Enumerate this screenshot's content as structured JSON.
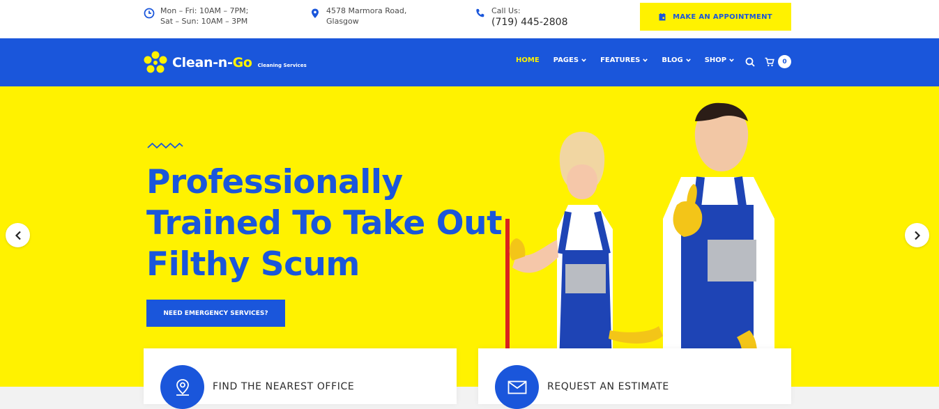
{
  "topbar": {
    "hours_line1": "Mon – Fri: 10AM – 7PM;",
    "hours_line2": "Sat – Sun: 10AM – 3PM",
    "address_line1": "4578 Marmora Road,",
    "address_line2": "Glasgow",
    "call_label": "Call Us:",
    "phone": "(719) 445-2808",
    "appointment_button": "MAKE AN APPOINTMENT",
    "icons": [
      "clock-icon",
      "map-pin-icon",
      "phone-icon",
      "calendar-icon"
    ]
  },
  "navbar": {
    "logo_main": "Clean-n-",
    "logo_accent": "Go",
    "logo_tagline": "Cleaning Services",
    "menu": [
      {
        "label": "HOME",
        "active": true,
        "dropdown": false
      },
      {
        "label": "PAGES",
        "active": false,
        "dropdown": true
      },
      {
        "label": "FEATURES",
        "active": false,
        "dropdown": true
      },
      {
        "label": "BLOG",
        "active": false,
        "dropdown": true
      },
      {
        "label": "SHOP",
        "active": false,
        "dropdown": true
      }
    ],
    "cart_count": "0"
  },
  "hero": {
    "headline_line1": "Professionally",
    "headline_line2": "Trained To Take Out",
    "headline_line3": "Filthy Scum",
    "cta": "NEED EMERGENCY SERVICES?"
  },
  "cards": [
    {
      "title": "FIND THE NEAREST OFFICE",
      "icon": "location-icon"
    },
    {
      "title": "REQUEST AN ESTIMATE",
      "icon": "envelope-icon"
    }
  ],
  "colors": {
    "brand_blue": "#1a56db",
    "brand_yellow": "#fff200",
    "white": "#ffffff"
  }
}
